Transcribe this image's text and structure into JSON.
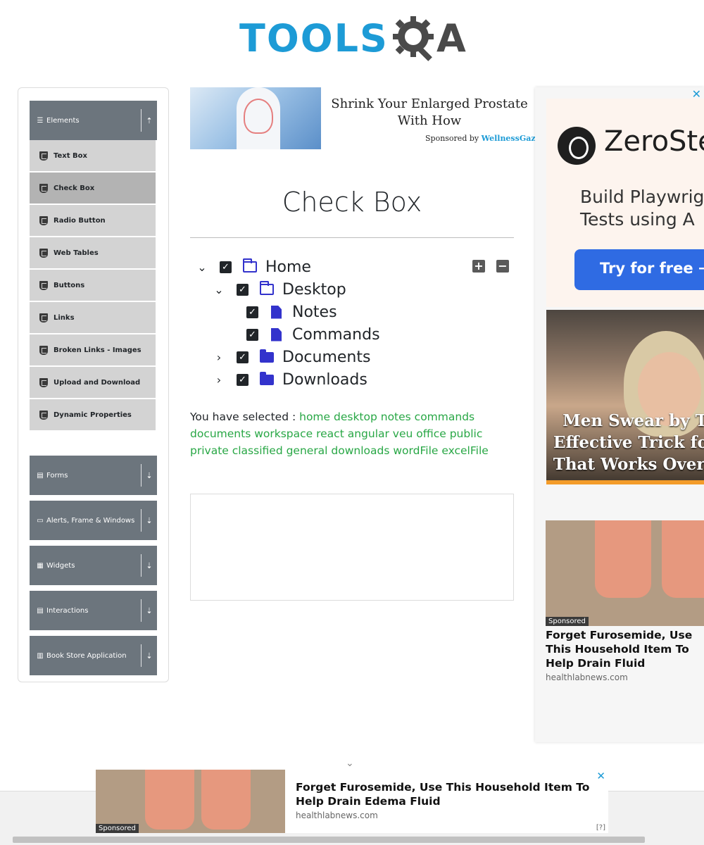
{
  "logo": {
    "text_left": "TOOLS",
    "text_right": "A"
  },
  "sidebar": {
    "groups": [
      {
        "label": "Elements",
        "icon": "hamburger-icon",
        "arrow": "upload-icon"
      },
      {
        "label": "Forms",
        "icon": "doc-icon",
        "arrow": "download-icon"
      },
      {
        "label": "Alerts, Frame & Windows",
        "icon": "window-icon",
        "arrow": "download-icon"
      },
      {
        "label": "Widgets",
        "icon": "grid-icon",
        "arrow": "download-icon"
      },
      {
        "label": "Interactions",
        "icon": "list-icon",
        "arrow": "download-icon"
      },
      {
        "label": "Book Store Application",
        "icon": "chart-icon",
        "arrow": "download-icon"
      }
    ],
    "items": [
      {
        "label": "Text Box"
      },
      {
        "label": "Check Box"
      },
      {
        "label": "Radio Button"
      },
      {
        "label": "Web Tables"
      },
      {
        "label": "Buttons"
      },
      {
        "label": "Links"
      },
      {
        "label": "Broken Links - Images"
      },
      {
        "label": "Upload and Download"
      },
      {
        "label": "Dynamic Properties"
      }
    ],
    "active_item": "Check Box"
  },
  "ad_top": {
    "headline": "Shrink Your Enlarged Prostate With How",
    "sponsor_prefix": "Sponsored by",
    "sponsor_brand": "WellnessGaze Pr"
  },
  "main": {
    "title": "Check Box",
    "tree": {
      "home": "Home",
      "desktop": "Desktop",
      "notes": "Notes",
      "commands": "Commands",
      "documents": "Documents",
      "downloads": "Downloads"
    },
    "expand_all": "+",
    "collapse_all": "−",
    "result_prefix": "You have selected :",
    "selected": "home desktop notes commands documents workspace react angular veu office public private classified general downloads wordFile excelFile"
  },
  "right_ad": {
    "close": "✕",
    "brand": "ZeroSte",
    "tagline_1": "Build Playwrig",
    "tagline_2": "Tests using A",
    "cta": "Try for free →",
    "face_caption_1": "Men Swear by T",
    "face_caption_2": "Effective Trick for",
    "face_caption_3": "That Works Overn",
    "sponsored": "Sponsored",
    "feet_title": "Forget Furosemide, Use This Household Item To Help Drain Fluid",
    "feet_source": "healthlabnews.com"
  },
  "bottom_ad": {
    "title": "Forget Furosemide, Use This Household Item To Help Drain Edema Fluid",
    "source": "healthlabnews.com",
    "sponsored": "Sponsored",
    "close": "✕",
    "adinfo": "[?]",
    "chevron": "⌄"
  }
}
